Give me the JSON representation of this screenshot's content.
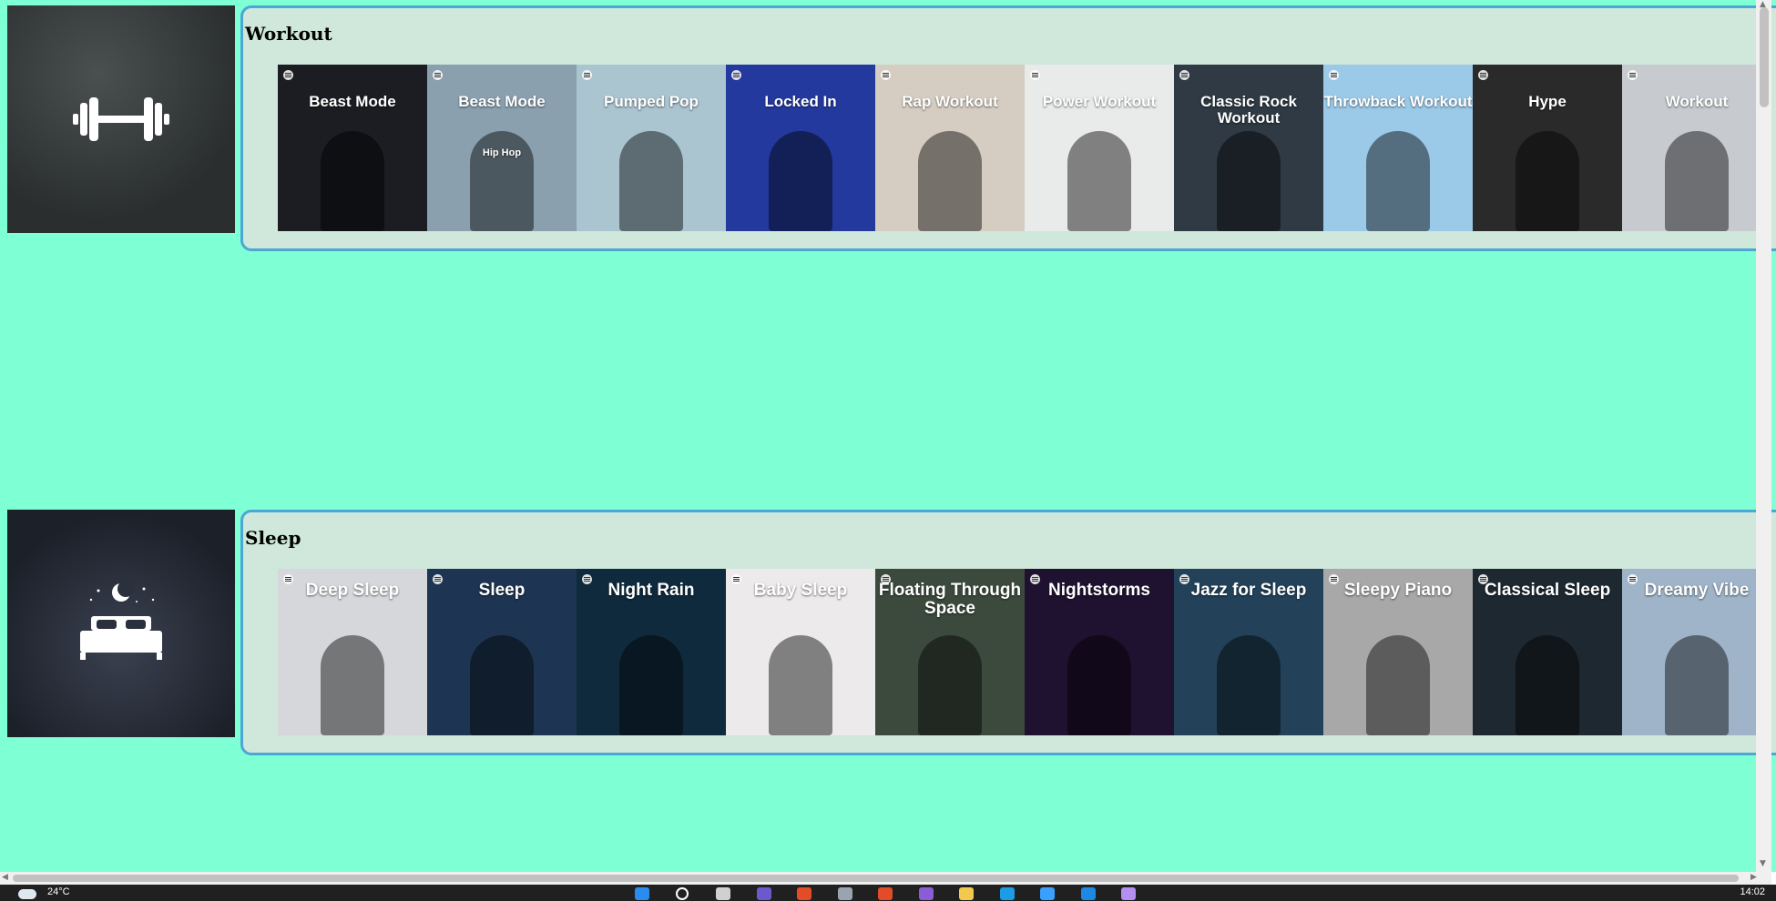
{
  "sections": [
    {
      "title": "Workout",
      "icon": "dumbbell-icon",
      "tiles": [
        {
          "text": "Beast Mode",
          "sub": "",
          "bg": "#1b1d22"
        },
        {
          "text": "Beast Mode",
          "sub": "Hip Hop",
          "bg": "#8aa0ae"
        },
        {
          "text": "Pumped Pop",
          "sub": "",
          "bg": "#aac4d0"
        },
        {
          "text": "Locked In",
          "sub": "",
          "bg": "#23399e"
        },
        {
          "text": "Rap Workout",
          "sub": "",
          "bg": "#d6cdc2"
        },
        {
          "text": "Power Workout",
          "sub": "",
          "bg": "#e9eaea"
        },
        {
          "text": "Classic Rock Workout",
          "sub": "",
          "bg": "#2f3a44"
        },
        {
          "text": "Throwback Workout",
          "sub": "",
          "bg": "#9bc9e8"
        },
        {
          "text": "Hype",
          "sub": "",
          "bg": "#2a2a2a"
        },
        {
          "text": "Workout",
          "sub": "",
          "bg": "#c7cbd0"
        }
      ]
    },
    {
      "title": "Sleep",
      "icon": "bed-icon",
      "tiles": [
        {
          "text": "Deep Sleep",
          "sub": "",
          "bg": "#d5d7da"
        },
        {
          "text": "Sleep",
          "sub": "",
          "bg": "#1d3552"
        },
        {
          "text": "Night Rain",
          "sub": "",
          "bg": "#0f2a3d"
        },
        {
          "text": "Baby Sleep",
          "sub": "",
          "bg": "#eceaea"
        },
        {
          "text": "Floating Through Space",
          "sub": "",
          "bg": "#3c4a3d"
        },
        {
          "text": "Nightstorms",
          "sub": "",
          "bg": "#1f1230"
        },
        {
          "text": "Jazz for Sleep",
          "sub": "",
          "bg": "#23425a"
        },
        {
          "text": "Sleepy Piano",
          "sub": "",
          "bg": "#a8a8a8"
        },
        {
          "text": "Classical Sleep",
          "sub": "",
          "bg": "#1e2831"
        },
        {
          "text": "Dreamy Vibe",
          "sub": "",
          "bg": "#9fb4c8"
        }
      ]
    }
  ],
  "taskbar": {
    "temperature": "24°C",
    "time": "14:02"
  },
  "colors": {
    "page_bg": "#7fffd4",
    "card_bg": "#cfe8db",
    "card_border": "#4ba7d6",
    "taskbar": "#202020"
  },
  "taskbar_icons": [
    "start-icon",
    "search-icon",
    "task-view-icon",
    "teams-icon",
    "chrome-icon",
    "settings-icon",
    "chrome-icon",
    "visual-studio-icon",
    "file-explorer-icon",
    "edge-icon",
    "notepad-icon",
    "vscode-icon",
    "github-icon"
  ]
}
